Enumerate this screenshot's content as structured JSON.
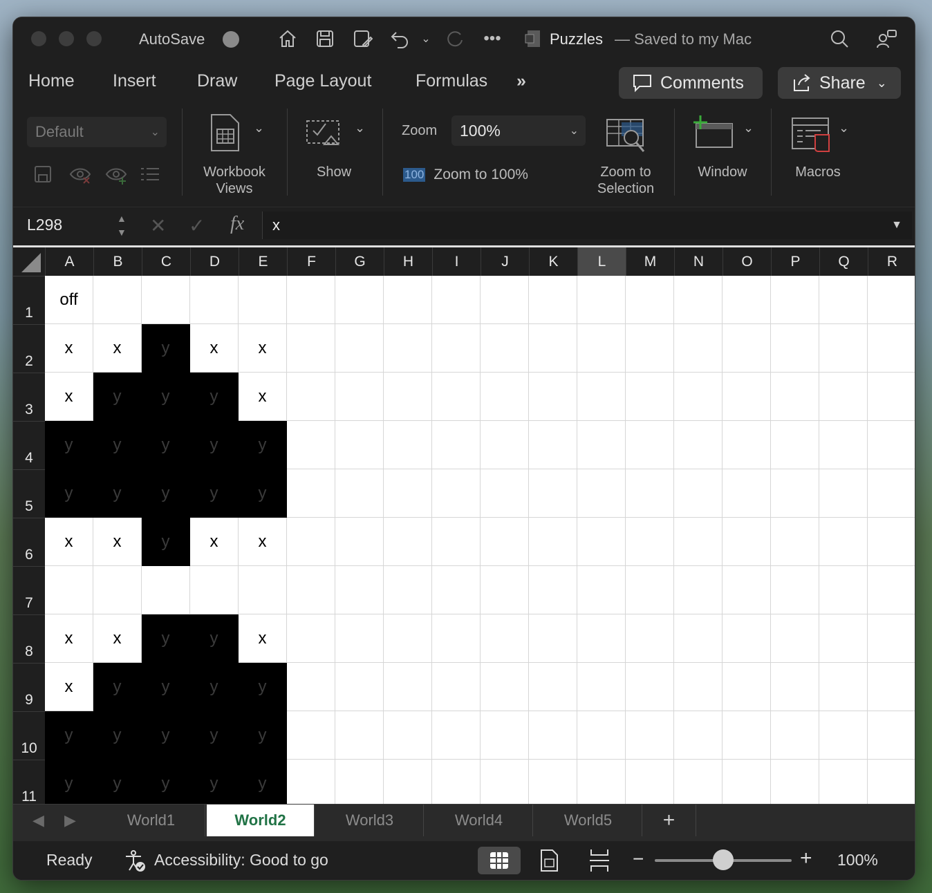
{
  "titlebar": {
    "autosave_label": "AutoSave",
    "doc_title": "Puzzles",
    "saved_status": "— Saved to my Mac"
  },
  "tabs": [
    "Home",
    "Insert",
    "Draw",
    "Page Layout",
    "Formulas"
  ],
  "buttons": {
    "comments": "Comments",
    "share": "Share"
  },
  "ribbon": {
    "style_dropdown": "Default",
    "workbook_views": "Workbook\nViews",
    "show": "Show",
    "zoom_label": "Zoom",
    "zoom_value": "100%",
    "zoom_100_badge": "100",
    "zoom_to_100": "Zoom to 100%",
    "zoom_to_selection": "Zoom to\nSelection",
    "window": "Window",
    "macros": "Macros"
  },
  "formula_bar": {
    "name_box": "L298",
    "fx": "fx",
    "value": "x"
  },
  "columns": [
    "A",
    "B",
    "C",
    "D",
    "E",
    "F",
    "G",
    "H",
    "I",
    "J",
    "K",
    "L",
    "M",
    "N",
    "O",
    "P",
    "Q",
    "R"
  ],
  "selected_column": "L",
  "rows": [
    {
      "num": "1",
      "cells": [
        "off",
        "",
        "",
        "",
        ""
      ],
      "black": [
        0,
        0,
        0,
        0,
        0
      ]
    },
    {
      "num": "2",
      "cells": [
        "x",
        "x",
        "y",
        "x",
        "x"
      ],
      "black": [
        0,
        0,
        1,
        0,
        0
      ]
    },
    {
      "num": "3",
      "cells": [
        "x",
        "y",
        "y",
        "y",
        "x"
      ],
      "black": [
        0,
        1,
        1,
        1,
        0
      ]
    },
    {
      "num": "4",
      "cells": [
        "y",
        "y",
        "y",
        "y",
        "y"
      ],
      "black": [
        1,
        1,
        1,
        1,
        1
      ]
    },
    {
      "num": "5",
      "cells": [
        "y",
        "y",
        "y",
        "y",
        "y"
      ],
      "black": [
        1,
        1,
        1,
        1,
        1
      ]
    },
    {
      "num": "6",
      "cells": [
        "x",
        "x",
        "y",
        "x",
        "x"
      ],
      "black": [
        0,
        0,
        1,
        0,
        0
      ]
    },
    {
      "num": "7",
      "cells": [
        "",
        "",
        "",
        "",
        ""
      ],
      "black": [
        0,
        0,
        0,
        0,
        0
      ]
    },
    {
      "num": "8",
      "cells": [
        "x",
        "x",
        "y",
        "y",
        "x"
      ],
      "black": [
        0,
        0,
        1,
        1,
        0
      ]
    },
    {
      "num": "9",
      "cells": [
        "x",
        "y",
        "y",
        "y",
        "y"
      ],
      "black": [
        0,
        1,
        1,
        1,
        1
      ]
    },
    {
      "num": "10",
      "cells": [
        "y",
        "y",
        "y",
        "y",
        "y"
      ],
      "black": [
        1,
        1,
        1,
        1,
        1
      ]
    },
    {
      "num": "11",
      "cells": [
        "y",
        "y",
        "y",
        "y",
        "y"
      ],
      "black": [
        1,
        1,
        1,
        1,
        1
      ]
    }
  ],
  "sheets": [
    "World1",
    "World2",
    "World3",
    "World4",
    "World5"
  ],
  "active_sheet": "World2",
  "status": {
    "ready": "Ready",
    "accessibility": "Accessibility: Good to go",
    "zoom": "100%"
  },
  "colors": {
    "accent_green": "#217346",
    "dark_bg": "#1f1f1f"
  }
}
